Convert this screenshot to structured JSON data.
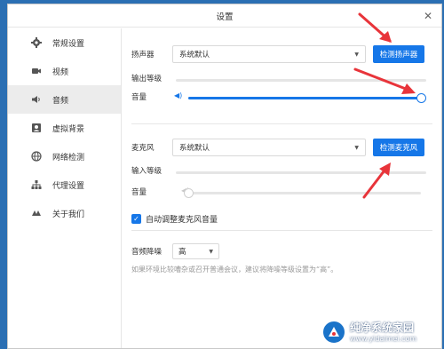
{
  "window": {
    "title": "设置"
  },
  "sidebar": {
    "items": [
      {
        "label": "常规设置",
        "icon": "gear-icon"
      },
      {
        "label": "视频",
        "icon": "video-camera-icon"
      },
      {
        "label": "音频",
        "icon": "speaker-icon"
      },
      {
        "label": "虚拟背景",
        "icon": "user-portrait-icon"
      },
      {
        "label": "网络检测",
        "icon": "globe-icon"
      },
      {
        "label": "代理设置",
        "icon": "network-tree-icon"
      },
      {
        "label": "关于我们",
        "icon": "logo-icon"
      }
    ],
    "active_index": 2
  },
  "speaker": {
    "label": "扬声器",
    "device": "系统默认",
    "test_button": "检测扬声器",
    "output_level_label": "输出等级",
    "volume_label": "音量",
    "output_level": 0,
    "volume": 1.0
  },
  "microphone": {
    "label": "麦克风",
    "device": "系统默认",
    "test_button": "检测麦克风",
    "input_level_label": "输入等级",
    "volume_label": "音量",
    "input_level": 0,
    "volume": 0.0
  },
  "auto_adjust": {
    "label": "自动调整麦克风音量",
    "checked": true
  },
  "noise": {
    "label": "音频降噪",
    "value": "高",
    "hint": "如果环境比较嘈杂或召开普通会议，建议将降噪等级设置为“高”。"
  },
  "watermark": {
    "line1": "纯净系统家园",
    "line2": "www.yidaimei.com"
  },
  "colors": {
    "accent": "#1677e8",
    "annotation_arrow": "#e8343a"
  }
}
